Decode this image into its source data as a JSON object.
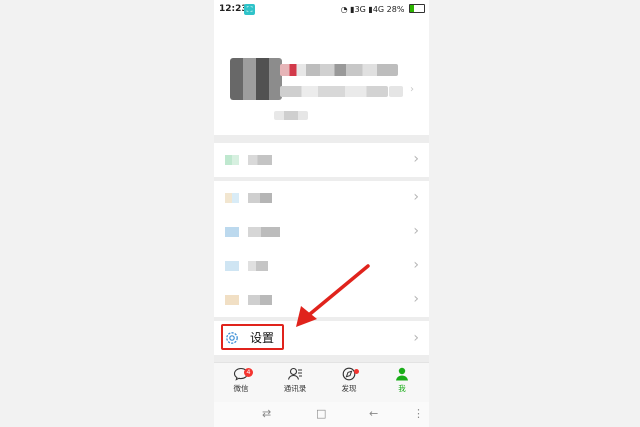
{
  "status_bar": {
    "time": "12:23",
    "signal_3g": "3G",
    "signal_4g": "4G",
    "battery": "28%"
  },
  "settings_label": "设置",
  "tabs": [
    {
      "label": "微信",
      "icon": "chat-icon",
      "badge": "4"
    },
    {
      "label": "通讯录",
      "icon": "contacts-icon"
    },
    {
      "label": "发现",
      "icon": "compass-icon"
    },
    {
      "label": "我",
      "icon": "person-icon"
    }
  ],
  "nav_bar": {
    "switch": "⇄",
    "home": "□",
    "back": "←",
    "menu": "⋮"
  },
  "colors": {
    "accent": "#1aad19",
    "highlight": "#e0231c",
    "badge": "#f43530"
  }
}
